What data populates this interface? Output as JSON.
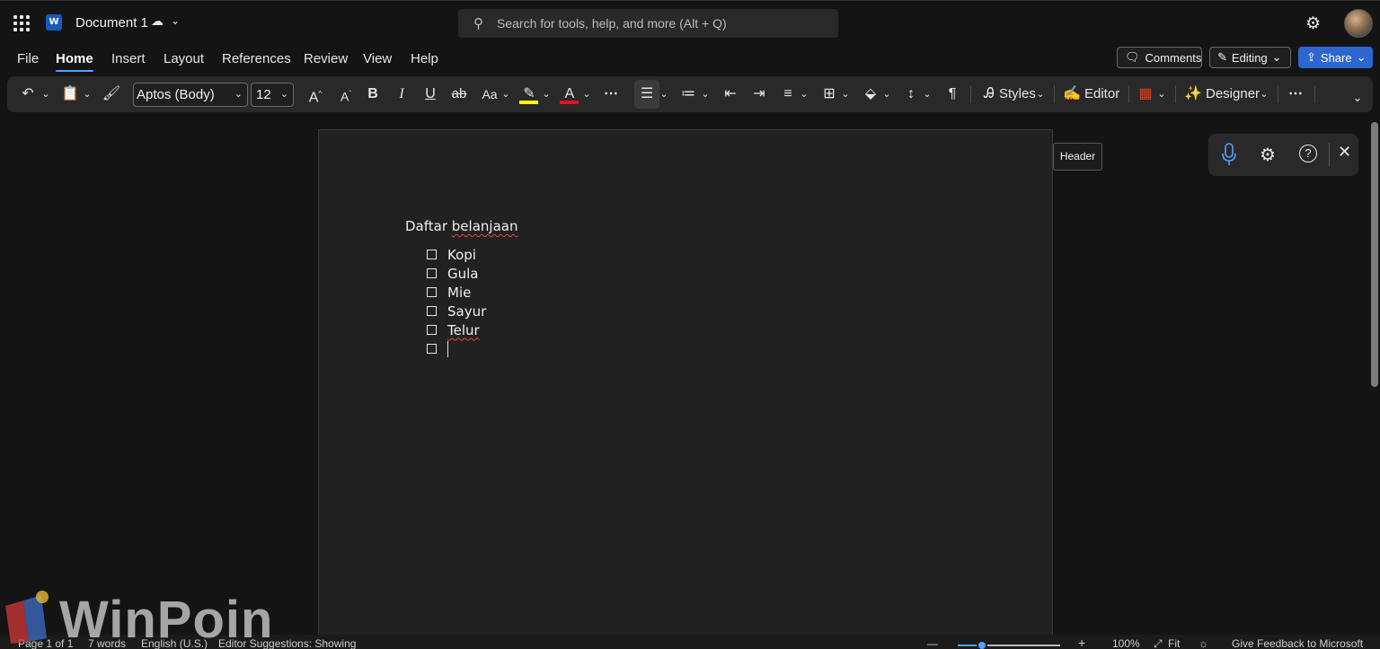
{
  "titlebar": {
    "app_icon": "word-icon",
    "app_letter": "W",
    "doc_title": "Document 1",
    "search_placeholder": "Search for tools, help, and more (Alt + Q)"
  },
  "menu": {
    "tabs": [
      "File",
      "Home",
      "Insert",
      "Layout",
      "References",
      "Review",
      "View",
      "Help"
    ],
    "active_tab": "Home",
    "comments_label": "Comments",
    "editing_label": "Editing",
    "share_label": "Share"
  },
  "ribbon": {
    "font_name": "Aptos (Body)",
    "font_size": "12",
    "styles_label": "Styles",
    "editor_label": "Editor",
    "designer_label": "Designer",
    "highlight_color": "#ffff00",
    "font_color": "#e81123"
  },
  "document": {
    "heading_word1": "Daftar",
    "heading_word2": "belanjaan",
    "items": [
      "Kopi",
      "Gula",
      "Mie",
      "Sayur",
      "Telur"
    ]
  },
  "tooltip": {
    "header": "Header"
  },
  "status": {
    "page": "Page 1 of 1",
    "words": "7 words",
    "language": "English (U.S.)",
    "editor": "Editor Suggestions: Showing",
    "zoom_minus": "—",
    "zoom_plus": "+",
    "zoom_level": "100%",
    "zoom_value": 1.0,
    "fit_label": "Fit",
    "feedback": "Give Feedback to Microsoft"
  },
  "watermark": {
    "text": "WinPoin"
  },
  "colors": {
    "accent": "#4da3ff",
    "share_button": "#2d66d1",
    "page_background": "#212121",
    "app_background": "#141414"
  }
}
